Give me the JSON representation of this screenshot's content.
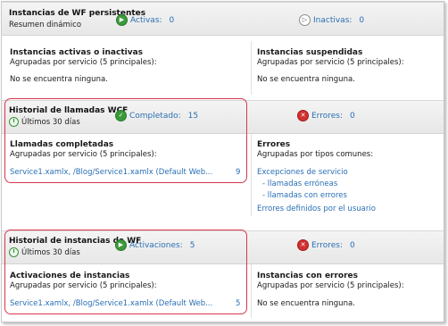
{
  "wf_persistent": {
    "title": "Instancias de WF persistentes",
    "subtitle": "Resumen dinámico",
    "active_label": "Activas:",
    "active_count": "0",
    "inactive_label": "Inactivas:",
    "inactive_count": "0",
    "left_panel": {
      "title": "Instancias activas o inactivas",
      "subtitle": "Agrupadas por servicio (5 principales):",
      "empty": "No se encuentra ninguna."
    },
    "right_panel": {
      "title": "Instancias suspendidas",
      "subtitle": "Agrupadas por servicio (5 principales):",
      "empty": "No se encuentra ninguna."
    }
  },
  "wcf_history": {
    "title": "Historial de llamadas WCF",
    "period": "Últimos 30 días",
    "completed_label": "Completado:",
    "completed_count": "15",
    "errors_label": "Errores:",
    "errors_count": "0",
    "left_panel": {
      "title": "Llamadas completadas",
      "subtitle": "Agrupadas por servicio (5 principales):",
      "link": "Service1.xamlx, /Blog/Service1.xamlx (Default Web...",
      "count": "9"
    },
    "right_panel": {
      "title": "Errores",
      "subtitle": "Agrupadas por tipos comunes:",
      "links": [
        "Excepciones de servicio",
        "- llamadas erróneas",
        "- llamadas con errores",
        "Errores definidos por el usuario"
      ]
    }
  },
  "wf_history": {
    "title": "Historial de instancias de WF",
    "period": "Últimos 30 días",
    "activations_label": "Activaciones:",
    "activations_count": "5",
    "errors_label": "Errores:",
    "errors_count": "0",
    "left_panel": {
      "title": "Activaciones de instancias",
      "subtitle": "Agrupadas por servicio (5 principales):",
      "link": "Service1.xamlx, /Blog/Service1.xamlx (Default Web...",
      "count": "5"
    },
    "right_panel": {
      "title": "Instancias con errores",
      "subtitle": "Agrupadas por servicio (5 principales):",
      "empty": "No se encuentra ninguna."
    }
  },
  "colors": {
    "link": "#2a6fb5",
    "highlight": "#d8364f",
    "ok_green": "#3b9a3b",
    "error_red": "#d23030"
  }
}
